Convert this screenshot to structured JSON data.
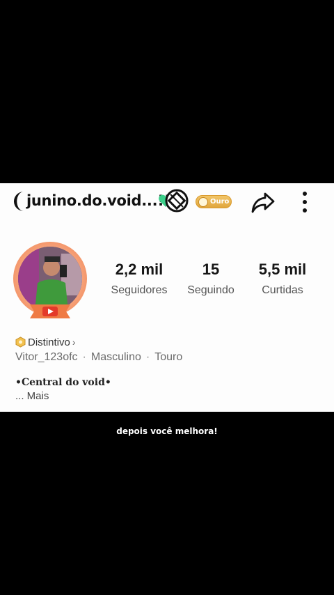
{
  "profile": {
    "username": "junino.do.void...!!",
    "badge_tier": "Ouro",
    "stats": [
      {
        "value": "2,2 mil",
        "label": "Seguidores"
      },
      {
        "value": "15",
        "label": "Seguindo"
      },
      {
        "value": "5,5 mil",
        "label": "Curtidas"
      }
    ],
    "distintivo_label": "Distintivo",
    "meta": {
      "handle": "Vitor_123ofc",
      "gender": "Masculino",
      "sign": "Touro",
      "separator": "·"
    },
    "bio_title": "•Central do void•",
    "bio_more": "...  Mais"
  },
  "caption": "depois você melhora!",
  "colors": {
    "gold_badge": "#e8b04c",
    "avatar_ring": "#ef7a44",
    "heart": "#3ccf8a"
  },
  "icons": {
    "moon": "crescent-moon-icon",
    "heart": "green-heart-icon",
    "share": "share-arrow-icon",
    "more": "vertical-dots-icon",
    "badge": "hexagon-badge-icon"
  }
}
